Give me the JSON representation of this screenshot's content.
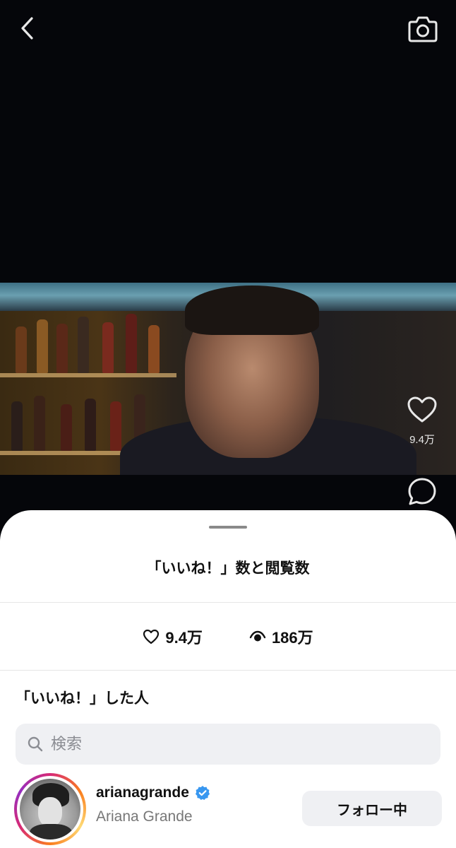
{
  "video": {
    "like_count": "9.4万"
  },
  "sheet": {
    "title": "「いいね！」数と閲覧数",
    "likes": "9.4万",
    "views": "186万",
    "section_title": "「いいね！」した人",
    "search_placeholder": "検索"
  },
  "users": [
    {
      "username": "arianagrande",
      "full_name": "Ariana Grande",
      "verified": true,
      "follow_label": "フォロー中"
    }
  ],
  "colors": {
    "background": "#05060a",
    "sheet": "#ffffff",
    "verified_badge": "#3897f0",
    "button_bg": "#eff0f3"
  },
  "icons": [
    "back-chevron-icon",
    "camera-icon",
    "heart-icon",
    "comment-icon",
    "eye-icon",
    "search-icon",
    "verified-badge-icon"
  ]
}
